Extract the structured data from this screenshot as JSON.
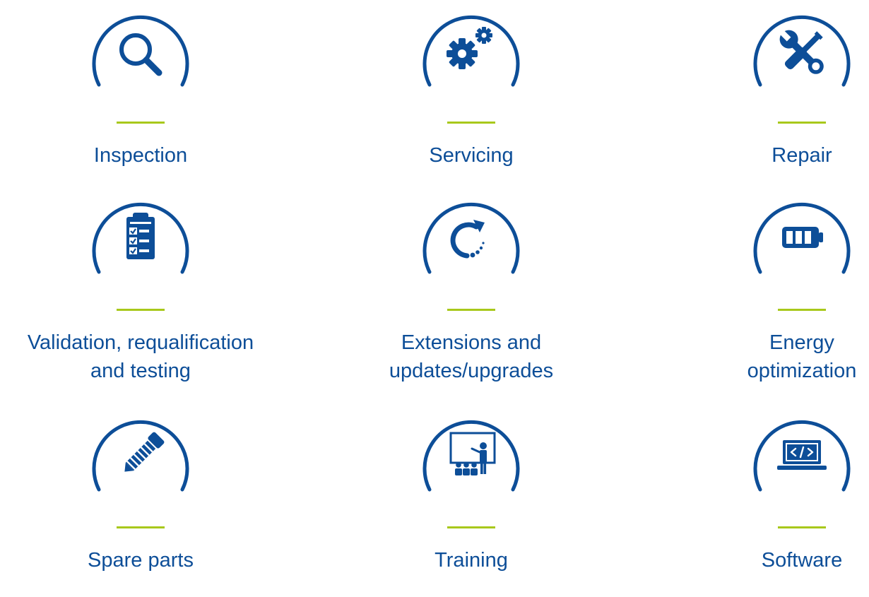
{
  "colors": {
    "brand_blue": "#0d4e98",
    "accent_green": "#a8c81b",
    "background": "#ffffff"
  },
  "services": [
    {
      "label": "Inspection",
      "icon": "magnifier-icon"
    },
    {
      "label": "Servicing",
      "icon": "gears-icon"
    },
    {
      "label": "Repair",
      "icon": "wrench-screwdriver-icon"
    },
    {
      "label": "Validation, requalification and testing",
      "label_lines": [
        "Validation, requalification",
        "and testing"
      ],
      "icon": "clipboard-checklist-icon"
    },
    {
      "label": "Extensions and updates/upgrades",
      "label_lines": [
        "Extensions and",
        "updates/upgrades"
      ],
      "icon": "refresh-arrow-icon"
    },
    {
      "label": "Energy optimization",
      "label_lines": [
        "Energy",
        "optimization"
      ],
      "icon": "battery-icon"
    },
    {
      "label": "Spare parts",
      "icon": "bolt-icon"
    },
    {
      "label": "Training",
      "icon": "presentation-icon"
    },
    {
      "label": "Software",
      "icon": "laptop-code-icon"
    }
  ]
}
